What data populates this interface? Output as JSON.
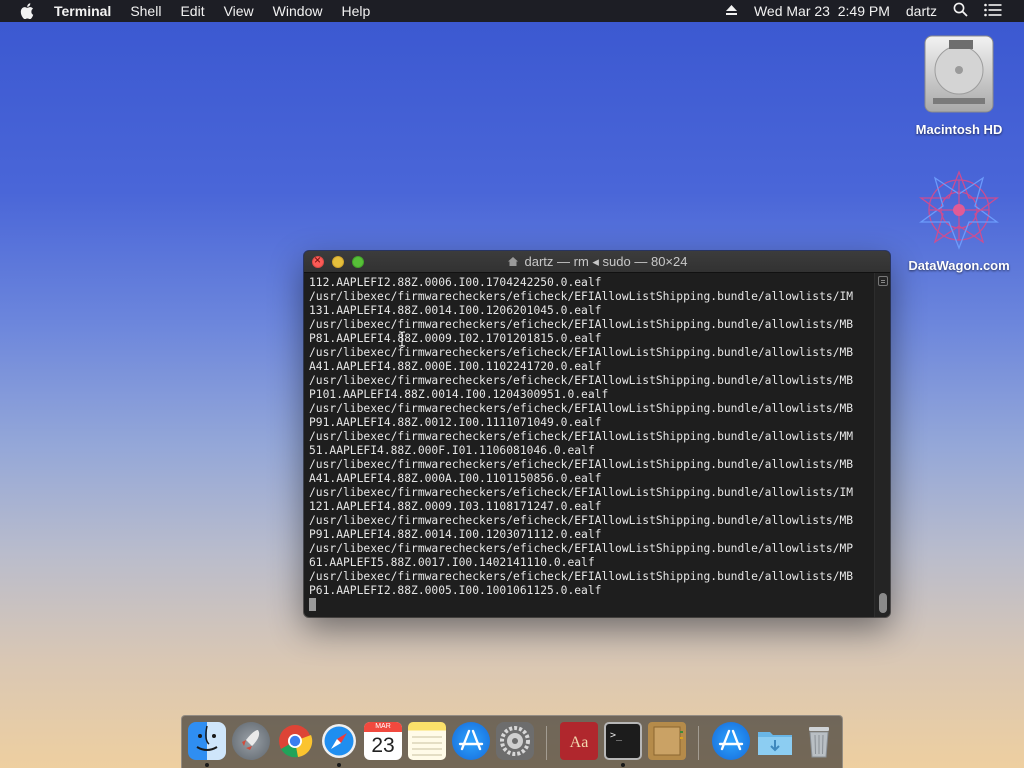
{
  "menubar": {
    "app_name": "Terminal",
    "menus": [
      "Shell",
      "Edit",
      "View",
      "Window",
      "Help"
    ],
    "datetime": "Wed Mar 23  2:49 PM",
    "user": "dartz"
  },
  "desktop": {
    "icons": [
      {
        "label": "Macintosh HD",
        "icon": "hard-drive-icon"
      },
      {
        "label": "DataWagon.com",
        "icon": "datawagon-icon"
      }
    ]
  },
  "terminal_window": {
    "title": "dartz — rm ◂ sudo — 80×24",
    "lines": [
      "112.AAPLEFI2.88Z.0006.I00.1704242250.0.ealf",
      "/usr/libexec/firmwarecheckers/eficheck/EFIAllowListShipping.bundle/allowlists/IM",
      "131.AAPLEFI4.88Z.0014.I00.1206201045.0.ealf",
      "/usr/libexec/firmwarecheckers/eficheck/EFIAllowListShipping.bundle/allowlists/MB",
      "P81.AAPLEFI4.88Z.0009.I02.1701201815.0.ealf",
      "/usr/libexec/firmwarecheckers/eficheck/EFIAllowListShipping.bundle/allowlists/MB",
      "A41.AAPLEFI4.88Z.000E.I00.1102241720.0.ealf",
      "/usr/libexec/firmwarecheckers/eficheck/EFIAllowListShipping.bundle/allowlists/MB",
      "P101.AAPLEFI4.88Z.0014.I00.1204300951.0.ealf",
      "/usr/libexec/firmwarecheckers/eficheck/EFIAllowListShipping.bundle/allowlists/MB",
      "P91.AAPLEFI4.88Z.0012.I00.1111071049.0.ealf",
      "/usr/libexec/firmwarecheckers/eficheck/EFIAllowListShipping.bundle/allowlists/MM",
      "51.AAPLEFI4.88Z.000F.I01.1106081046.0.ealf",
      "/usr/libexec/firmwarecheckers/eficheck/EFIAllowListShipping.bundle/allowlists/MB",
      "A41.AAPLEFI4.88Z.000A.I00.1101150856.0.ealf",
      "/usr/libexec/firmwarecheckers/eficheck/EFIAllowListShipping.bundle/allowlists/IM",
      "121.AAPLEFI4.88Z.0009.I03.1108171247.0.ealf",
      "/usr/libexec/firmwarecheckers/eficheck/EFIAllowListShipping.bundle/allowlists/MB",
      "P91.AAPLEFI4.88Z.0014.I00.1203071112.0.ealf",
      "/usr/libexec/firmwarecheckers/eficheck/EFIAllowListShipping.bundle/allowlists/MP",
      "61.AAPLEFI5.88Z.0017.I00.1402141110.0.ealf",
      "/usr/libexec/firmwarecheckers/eficheck/EFIAllowListShipping.bundle/allowlists/MB",
      "P61.AAPLEFI2.88Z.0005.I00.1001061125.0.ealf"
    ]
  },
  "dock": {
    "calendar_month": "MAR",
    "calendar_day": "23",
    "items": [
      "finder",
      "launchpad",
      "chrome",
      "safari",
      "calendar",
      "notes",
      "app-store",
      "system-preferences",
      "dictionary",
      "terminal",
      "notebook",
      "app-store-downloads",
      "downloads-folder",
      "trash"
    ]
  },
  "colors": {
    "terminal_bg": "#1e1e1e",
    "terminal_text": "#e6e6e6",
    "menubar_bg": "#1c1c1e"
  }
}
